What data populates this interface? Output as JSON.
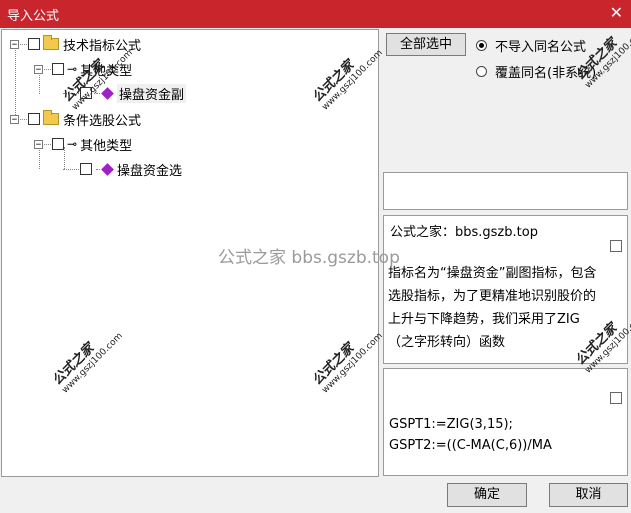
{
  "window": {
    "title": "导入公式",
    "close_icon": "close-icon"
  },
  "tree": {
    "node1": {
      "label": "技术指标公式",
      "child": {
        "label": "其他类型",
        "leaf": {
          "label": "操盘资金副"
        }
      }
    },
    "node2": {
      "label": "条件选股公式",
      "child": {
        "label": "其他类型",
        "leaf": {
          "label": "操盘资金选"
        }
      }
    }
  },
  "controls": {
    "select_all": "全部选中",
    "radio_skip": "不导入同名公式",
    "radio_overwrite": "覆盖同名(非系统)"
  },
  "description": {
    "header": "公式之家：bbs.gszb.top",
    "body": "指标名为“操盘资金”副图指标，包含选股指标，为了更精准地识别股价的上升与下降趋势，我们采用了ZIG（之字形转向）函数"
  },
  "code": {
    "line1": "GSPT1:=ZIG(3,15);",
    "line2": "GSPT2:=((C-MA(C,6))/MA"
  },
  "watermark": {
    "center": "公式之家 bbs.gszb.top",
    "stamp_title": "公式之家",
    "stamp_url": "www.gszj100.com"
  },
  "buttons": {
    "ok": "确定",
    "cancel": "取消"
  }
}
